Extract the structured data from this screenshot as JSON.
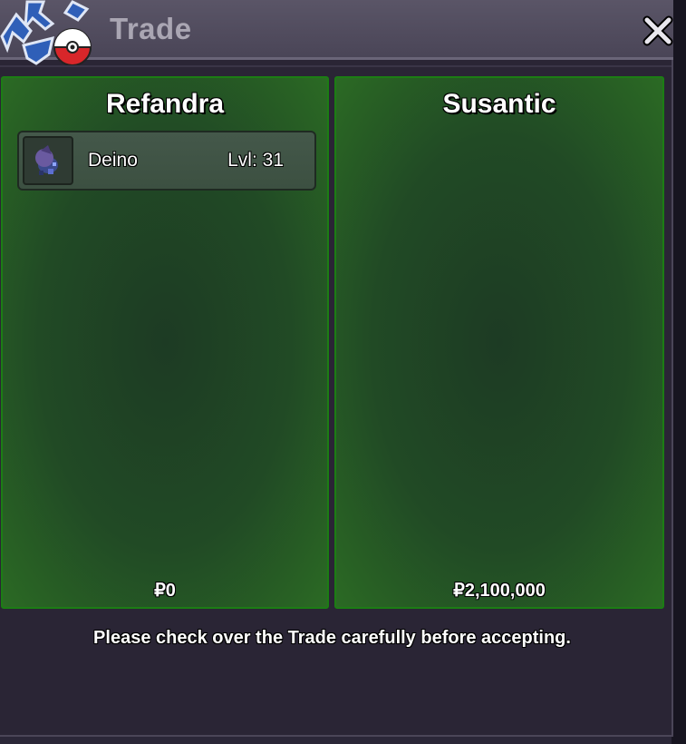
{
  "window": {
    "title": "Trade",
    "close_icon": "close-icon",
    "logo_icon": "trade-pokeball-icon"
  },
  "left_panel": {
    "player_name": "Refandra",
    "items": [
      {
        "name": "Deino",
        "level": "Lvl: 31",
        "icon": "deino-sprite-icon"
      }
    ],
    "money": "₽0"
  },
  "right_panel": {
    "player_name": "Susantic",
    "items": [],
    "money": "₽2,100,000"
  },
  "footer": {
    "notice": "Please check over the Trade carefully before accepting."
  },
  "colors": {
    "panel_border": "#1c7d14",
    "panel_bg": "#214a25",
    "window_bg": "#2a2535",
    "titlebar": "#4a4557"
  }
}
